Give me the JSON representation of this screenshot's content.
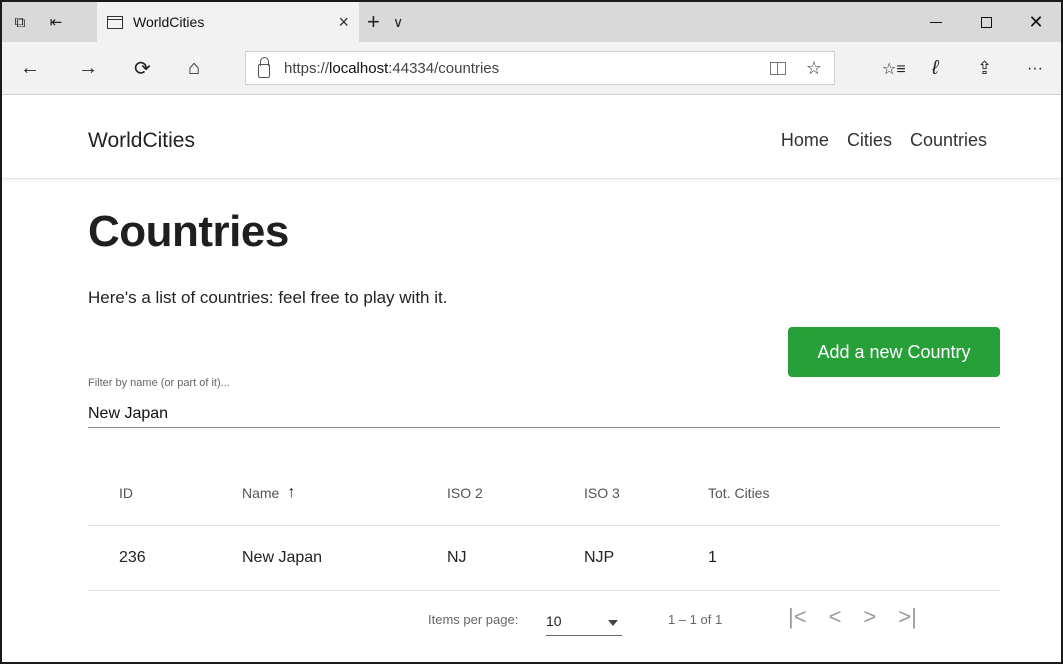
{
  "browser": {
    "tab_title": "WorldCities",
    "tab_close": "×",
    "new_tab": "+",
    "tab_menu": "∨",
    "url_scheme": "https://",
    "url_host": "localhost",
    "url_path": ":44334/countries",
    "back": "←",
    "forward": "→",
    "refresh": "⟳",
    "home": "⌂",
    "favorite": "☆",
    "favorites_hub": "☆≡",
    "notes": "ℓ",
    "share": "⇪",
    "more": "···"
  },
  "app": {
    "brand": "WorldCities",
    "nav": [
      "Home",
      "Cities",
      "Countries"
    ]
  },
  "main": {
    "title": "Countries",
    "subtitle": "Here's a list of countries: feel free to play with it.",
    "add_button": "Add a new Country",
    "filter": {
      "label": "Filter by name (or part of it)...",
      "value": "New Japan"
    }
  },
  "table": {
    "columns": [
      "ID",
      "Name",
      "ISO 2",
      "ISO 3",
      "Tot. Cities"
    ],
    "sort_indicator": "↑",
    "rows": [
      {
        "id": "236",
        "name": "New Japan",
        "iso2": "NJ",
        "iso3": "NJP",
        "tot_cities": "1"
      }
    ]
  },
  "paginator": {
    "items_per_page_label": "Items per page:",
    "items_per_page": "10",
    "range": "1 – 1 of 1",
    "first": "|<",
    "prev": "<",
    "next": ">",
    "last": ">|"
  }
}
